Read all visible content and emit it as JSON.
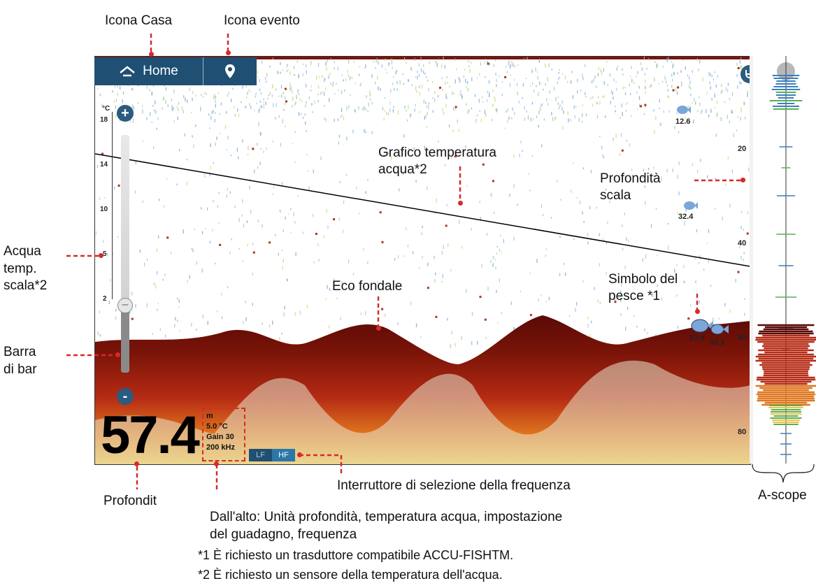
{
  "colors": {
    "bar_blue": "#1f4f73",
    "marker_red": "#d62a2a",
    "echo_dark": "#5a0a06",
    "echo_red": "#b52a14"
  },
  "toolbar": {
    "home_icon": "home-icon",
    "home_label": "Home",
    "event_icon": "pin-icon"
  },
  "zoom": {
    "in_symbol": "+",
    "out_symbol": "-"
  },
  "temp_scale": {
    "unit": "°C",
    "ticks": [
      "18",
      "14",
      "10",
      "5",
      "2"
    ]
  },
  "depth_scale": {
    "ticks": [
      "20",
      "40",
      "60",
      "80"
    ]
  },
  "depth_readout": "57.4",
  "info": {
    "unit": "m",
    "temp": "5.0 °C",
    "gain": "Gain 30",
    "freq": "200 kHz"
  },
  "freq_switch": {
    "lf": "LF",
    "hf": "HF"
  },
  "fish": [
    {
      "label": "12.6"
    },
    {
      "label": "32.4"
    },
    {
      "label": "57.8"
    },
    {
      "label": "59.1"
    }
  ],
  "annotations": {
    "home_icon": "Icona Casa",
    "event_icon": "Icona evento",
    "temp_graph_1": "Grafico temperatura",
    "temp_graph_2": "acqua*2",
    "depth_scale_1": "Profondità",
    "depth_scale_2": "scala",
    "temp_scale_1": "Acqua",
    "temp_scale_2": "temp.",
    "temp_scale_3": "scala*2",
    "bottom_echo": "Eco fondale",
    "fish_symbol_1": "Simbolo del",
    "fish_symbol_2": "pesce *1",
    "gain_bar_1": "Barra",
    "gain_bar_2": "di bar",
    "freq_switch": "Interruttore di selezione della frequenza",
    "ascope": "A-scope",
    "depth": "Profondit",
    "info_box_1": "Dall'alto: Unità profondità, temperatura acqua, impostazione",
    "info_box_2": "del guadagno, frequenza",
    "footnote_1": "*1 È richiesto un trasduttore compatibile ACCU-FISHTM.",
    "footnote_2": "*2 È richiesto un sensore della temperatura dell'acqua."
  }
}
